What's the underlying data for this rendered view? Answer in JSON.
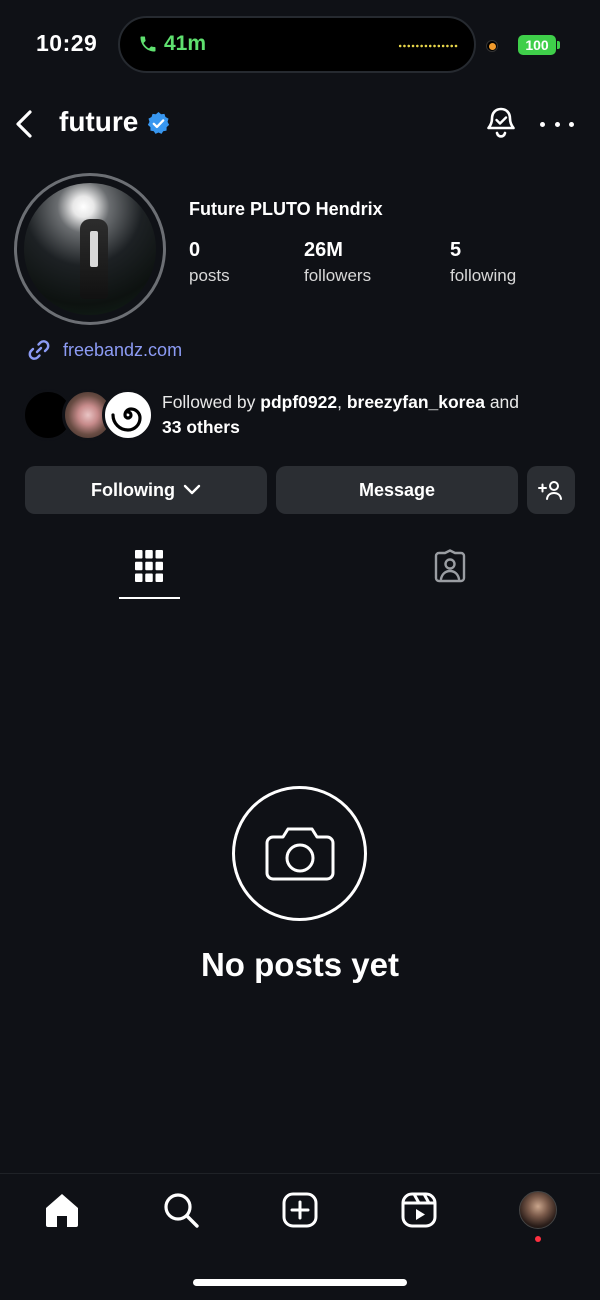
{
  "status_bar": {
    "time": "10:29",
    "call_duration": "41m",
    "battery": "100"
  },
  "header": {
    "username": "future",
    "verified": true,
    "back_icon": "chevron-left-icon",
    "notification_icon": "bell-icon",
    "more_icon": "more-horizontal-icon"
  },
  "profile": {
    "full_name": "Future PLUTO Hendrix",
    "stats": [
      {
        "value": "0",
        "label": "posts"
      },
      {
        "value": "26M",
        "label": "followers"
      },
      {
        "value": "5",
        "label": "following"
      }
    ],
    "link": "freebandz.com",
    "followed_by": {
      "prefix": "Followed by ",
      "user1": "pdpf0922",
      "separator": ", ",
      "user2": "breezyfan_korea",
      "joiner": " and",
      "others": "33 others"
    }
  },
  "actions": {
    "following_label": "Following",
    "message_label": "Message",
    "add_icon": "add-person-icon"
  },
  "tabs": [
    {
      "name": "grid",
      "icon": "grid-icon",
      "active": true
    },
    {
      "name": "tagged",
      "icon": "tagged-person-icon",
      "active": false
    }
  ],
  "empty_state": {
    "icon": "camera-icon",
    "message": "No posts yet"
  },
  "bottom_nav": [
    {
      "name": "home",
      "icon": "home-icon"
    },
    {
      "name": "search",
      "icon": "search-icon"
    },
    {
      "name": "create",
      "icon": "plus-square-icon"
    },
    {
      "name": "reels",
      "icon": "reels-icon"
    },
    {
      "name": "profile",
      "icon": "avatar"
    }
  ],
  "colors": {
    "background": "#0f1116",
    "button": "#2b2e33",
    "link": "#8c9bf4",
    "verified": "#3897f0",
    "call_green": "#5fe06f",
    "notification_dot": "#ff3040"
  }
}
